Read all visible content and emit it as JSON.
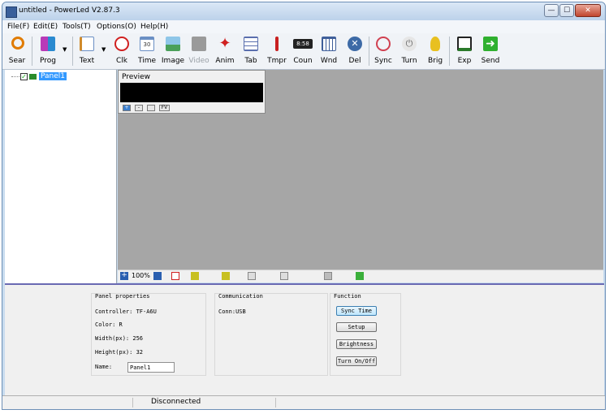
{
  "window": {
    "title": "untitled - PowerLed V2.87.3",
    "min_glyph": "—",
    "max_glyph": "☐",
    "close_glyph": "✕"
  },
  "menu": [
    "File(F)",
    "Edit(E)",
    "Tools(T)",
    "Options(O)",
    "Help(H)"
  ],
  "toolbar": [
    {
      "label": "Sear",
      "icon": "search-icon",
      "color": "#e07b00"
    },
    {
      "label": "Prog",
      "icon": "program-icon",
      "color": "#b83ab8"
    },
    {
      "label": "Text",
      "icon": "text-icon",
      "color": "#d08a2a"
    },
    {
      "label": "Clk",
      "icon": "clock-icon",
      "color": "#d02020"
    },
    {
      "label": "Time",
      "icon": "calendar-icon",
      "color": "#6a8fc4",
      "glyph": "30"
    },
    {
      "label": "Image",
      "icon": "image-icon",
      "color": "#4aa05a"
    },
    {
      "label": "Video",
      "icon": "video-icon",
      "color": "#9a9a9a",
      "disabled": true
    },
    {
      "label": "Anim",
      "icon": "animation-icon",
      "color": "#d02020"
    },
    {
      "label": "Tab",
      "icon": "table-icon",
      "color": "#5a6fae"
    },
    {
      "label": "Tmpr",
      "icon": "thermometer-icon",
      "color": "#c82020"
    },
    {
      "label": "Coun",
      "icon": "counter-icon",
      "color": "#222222",
      "glyph": "8:58"
    },
    {
      "label": "Wnd",
      "icon": "window-icon",
      "color": "#3f5f9a"
    },
    {
      "label": "Del",
      "icon": "delete-icon",
      "color": "#3d6aa6"
    },
    {
      "label": "Sync",
      "icon": "sync-clock-icon",
      "color": "#d04050"
    },
    {
      "label": "Turn",
      "icon": "power-icon",
      "color": "#666666"
    },
    {
      "label": "Brig",
      "icon": "bulb-icon",
      "color": "#e8c020"
    },
    {
      "label": "Exp",
      "icon": "export-usb-icon",
      "color": "#2a7a2a"
    },
    {
      "label": "Send",
      "icon": "send-arrow-icon",
      "color": "#2fb02f"
    }
  ],
  "tree": {
    "panel_name": "Panel1"
  },
  "preview": {
    "title": "Preview",
    "btn_plus": "+",
    "btn_minus": "-",
    "btn_fv": "FV"
  },
  "workspace_status": {
    "zoom": "100%"
  },
  "panel_properties": {
    "title": "Panel properties",
    "controller": "Controller: TF-A6U",
    "color": "Color: R",
    "width": "Width(px): 256",
    "height": "Height(px): 32",
    "name_label": "Name:",
    "name_value": "Panel1"
  },
  "communication": {
    "title": "Communication",
    "conn": "Conn:USB"
  },
  "function": {
    "title": "Function",
    "buttons": [
      "Sync Time",
      "Setup",
      "Brightness",
      "Turn On/Off"
    ]
  },
  "statusbar": {
    "text": "Disconnected"
  }
}
